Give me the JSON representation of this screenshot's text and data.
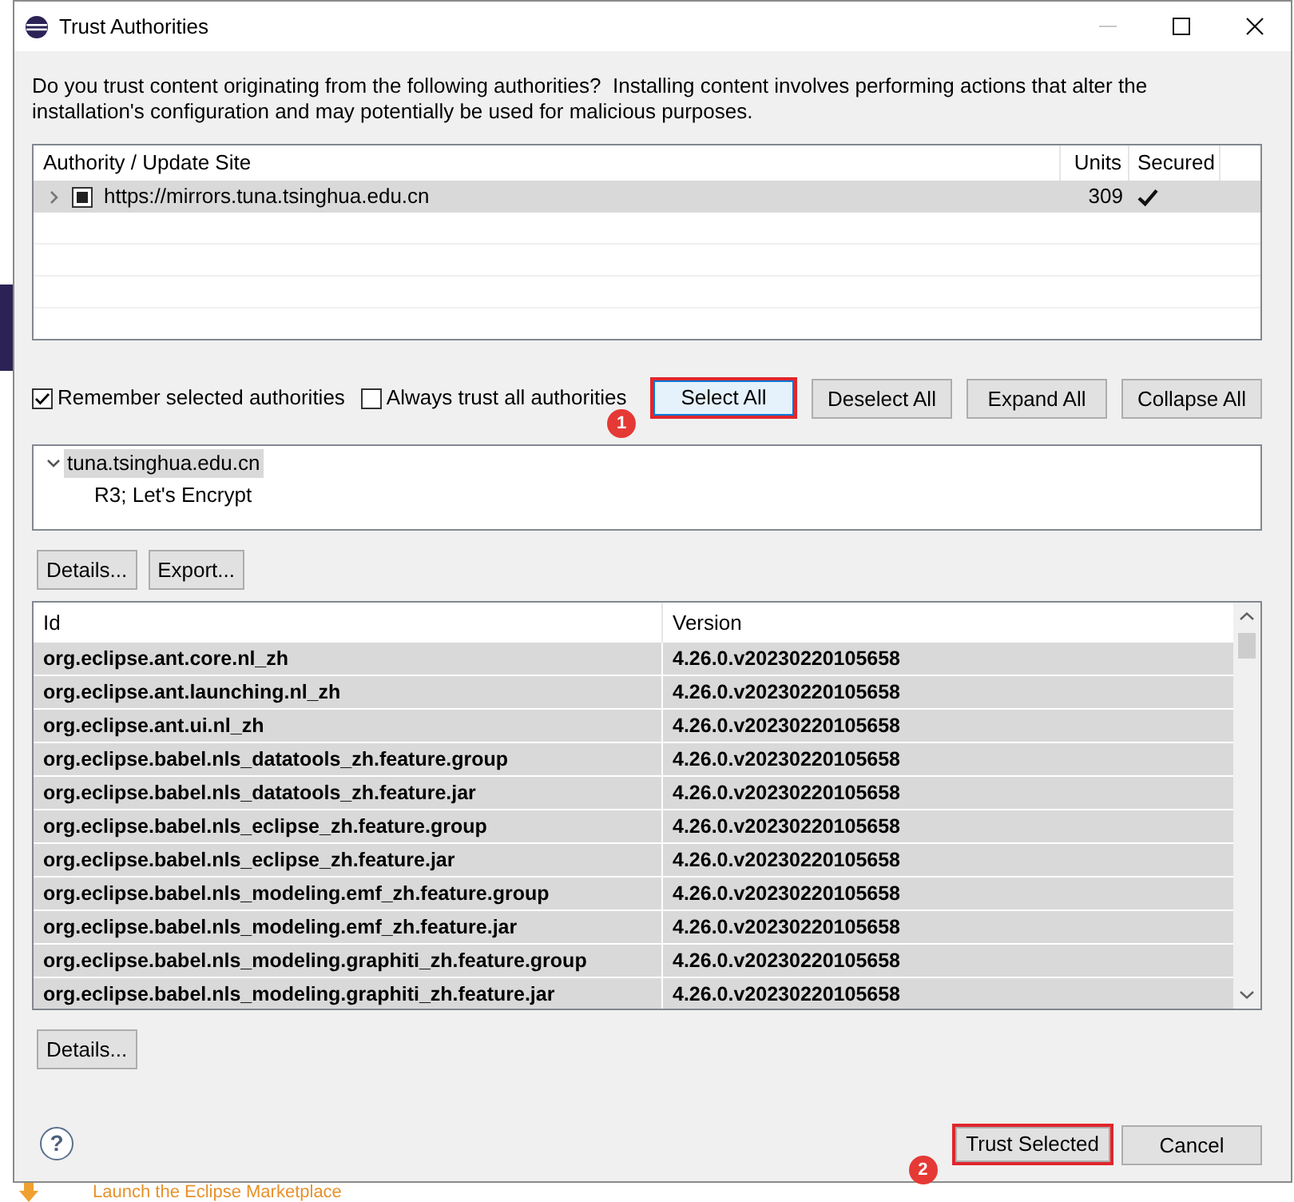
{
  "window": {
    "title": "Trust Authorities",
    "controls": [
      {
        "kind": "minimize",
        "disabled": true
      },
      {
        "kind": "maximize",
        "disabled": false
      },
      {
        "kind": "close",
        "disabled": false
      }
    ]
  },
  "message": "Do you trust content originating from the following authorities?  Installing content involves performing actions that alter the installation's configuration and may potentially be used for malicious purposes.",
  "authorities_table": {
    "columns": [
      "Authority / Update Site",
      "Units",
      "Secured"
    ],
    "rows": [
      {
        "site": "https://mirrors.tuna.tsinghua.edu.cn",
        "units": "309",
        "secured": true,
        "checked": true,
        "partial": true,
        "expanded": false,
        "selected": true
      }
    ]
  },
  "options": [
    {
      "label": "Remember selected authorities",
      "checked": true
    },
    {
      "label": "Always trust all authorities",
      "checked": false
    }
  ],
  "selection_buttons": [
    {
      "label": "Select All",
      "hovered": true,
      "step": "1"
    },
    {
      "label": "Deselect All",
      "hovered": false
    },
    {
      "label": "Expand All",
      "hovered": false
    },
    {
      "label": "Collapse All",
      "hovered": false
    }
  ],
  "certificate_tree": [
    {
      "label": "tuna.tsinghua.edu.cn",
      "expanded": true,
      "selected": true,
      "children": [
        {
          "label": "R3; Let's Encrypt",
          "selected": false
        }
      ]
    }
  ],
  "certificate_buttons": [
    "Details...",
    "Export..."
  ],
  "units_table": {
    "columns": [
      "Id",
      "Version"
    ],
    "rows": [
      {
        "id": "org.eclipse.ant.core.nl_zh",
        "version": "4.26.0.v20230220105658",
        "selected": true
      },
      {
        "id": "org.eclipse.ant.launching.nl_zh",
        "version": "4.26.0.v20230220105658",
        "selected": true
      },
      {
        "id": "org.eclipse.ant.ui.nl_zh",
        "version": "4.26.0.v20230220105658",
        "selected": true
      },
      {
        "id": "org.eclipse.babel.nls_datatools_zh.feature.group",
        "version": "4.26.0.v20230220105658",
        "selected": true
      },
      {
        "id": "org.eclipse.babel.nls_datatools_zh.feature.jar",
        "version": "4.26.0.v20230220105658",
        "selected": true
      },
      {
        "id": "org.eclipse.babel.nls_eclipse_zh.feature.group",
        "version": "4.26.0.v20230220105658",
        "selected": true
      },
      {
        "id": "org.eclipse.babel.nls_eclipse_zh.feature.jar",
        "version": "4.26.0.v20230220105658",
        "selected": true
      },
      {
        "id": "org.eclipse.babel.nls_modeling.emf_zh.feature.group",
        "version": "4.26.0.v20230220105658",
        "selected": true
      },
      {
        "id": "org.eclipse.babel.nls_modeling.emf_zh.feature.jar",
        "version": "4.26.0.v20230220105658",
        "selected": true
      },
      {
        "id": "org.eclipse.babel.nls_modeling.graphiti_zh.feature.group",
        "version": "4.26.0.v20230220105658",
        "selected": true
      },
      {
        "id": "org.eclipse.babel.nls_modeling.graphiti_zh.feature.jar",
        "version": "4.26.0.v20230220105658",
        "selected": true
      }
    ]
  },
  "units_buttons": [
    "Details..."
  ],
  "help_button": "?",
  "footer_buttons": [
    {
      "label": "Trust Selected",
      "hovered": false,
      "step": "2"
    },
    {
      "label": "Cancel",
      "hovered": false
    }
  ],
  "background": {
    "link": "Launch the Eclipse Marketplace"
  }
}
